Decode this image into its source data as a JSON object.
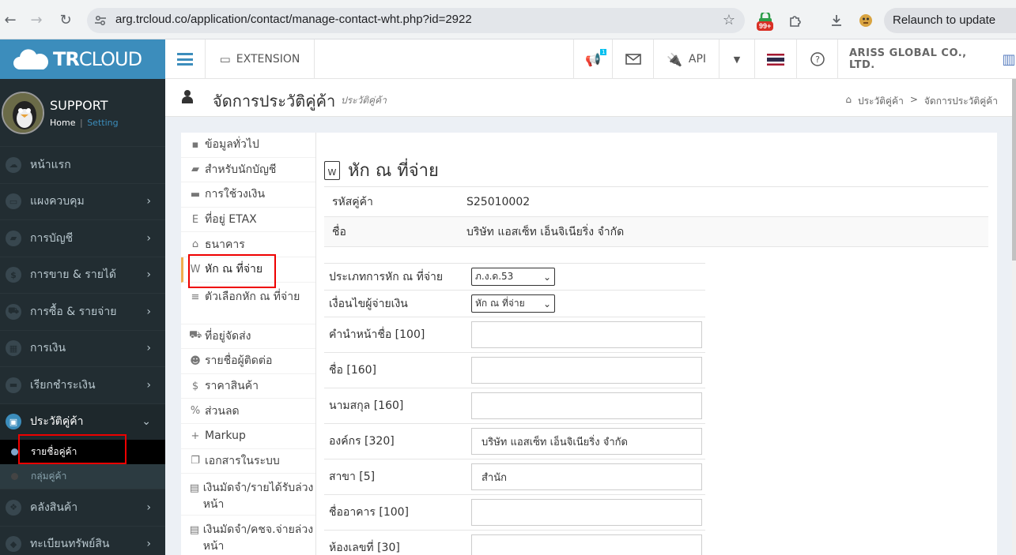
{
  "browser": {
    "url": "arg.trcloud.co/application/contact/manage-contact-wht.php?id=2922",
    "extension_badge": "99+",
    "relaunch_label": "Relaunch to update"
  },
  "brand": {
    "bold": "TR",
    "rest": "CLOUD"
  },
  "topbar": {
    "extension_label": "EXTENSION",
    "notification_count": "1",
    "api_label": "API",
    "company_name": "ARISS GLOBAL CO., LTD."
  },
  "user": {
    "name": "SUPPORT",
    "home_link": "Home",
    "separator": "|",
    "setting_link": "Setting"
  },
  "sidebar": {
    "items": [
      {
        "label": "หน้าแรก",
        "icon": "cloud-icon",
        "glyph": "☁",
        "has_arrow": false
      },
      {
        "label": "แผงควบคุม",
        "icon": "monitor-icon",
        "glyph": "▭",
        "has_arrow": true
      },
      {
        "label": "การบัญชี",
        "icon": "book-icon",
        "glyph": "▰",
        "has_arrow": true
      },
      {
        "label": "การขาย & รายได้",
        "icon": "dollar-icon",
        "glyph": "$",
        "has_arrow": true
      },
      {
        "label": "การซื้อ & รายจ่าย",
        "icon": "cart-icon",
        "glyph": "⛟",
        "has_arrow": true
      },
      {
        "label": "การเงิน",
        "icon": "calendar-icon",
        "glyph": "▦",
        "has_arrow": true
      },
      {
        "label": "เรียกชำระเงิน",
        "icon": "credit-card-icon",
        "glyph": "▬",
        "has_arrow": true
      },
      {
        "label": "ประวัติคู่ค้า",
        "icon": "contact-book-icon",
        "glyph": "▣",
        "has_arrow": true
      }
    ],
    "sub_items": [
      {
        "label": "รายชื่อคู่ค้า"
      },
      {
        "label": "กลุ่มคู่ค้า"
      }
    ],
    "bottom_items": [
      {
        "label": "คลังสินค้า",
        "icon": "cubes-icon",
        "glyph": "❖"
      },
      {
        "label": "ทะเบียนทรัพย์สิน",
        "icon": "diamond-icon",
        "glyph": "◆"
      }
    ]
  },
  "page": {
    "title": "จัดการประวัติคู่ค้า",
    "subtitle": "ประวัติคู่ค้า",
    "breadcrumb": [
      "ประวัติคู่ค้า",
      ">",
      "จัดการประวัติคู่ค้า"
    ]
  },
  "subnav": [
    {
      "label": "ข้อมูลทั่วไป",
      "glyph": "▪"
    },
    {
      "label": "สำหรับนักบัญชี",
      "glyph": "▰"
    },
    {
      "label": "การใช้วงเงิน",
      "glyph": "▬"
    },
    {
      "label": "ที่อยู่ ETAX",
      "glyph": "E"
    },
    {
      "label": "ธนาคาร",
      "glyph": "⌂"
    },
    {
      "label": "หัก ณ ที่จ่าย",
      "glyph": "W"
    },
    {
      "label": "ตัวเลือกหัก ณ ที่จ่าย",
      "glyph": "≡"
    },
    {
      "label": "ที่อยู่จัดส่ง",
      "glyph": "⛟"
    },
    {
      "label": "รายชื่อผู้ติดต่อ",
      "glyph": "☻"
    },
    {
      "label": "ราคาสินค้า",
      "glyph": "$"
    },
    {
      "label": "ส่วนลด",
      "glyph": "%"
    },
    {
      "label": "Markup",
      "glyph": "+"
    },
    {
      "label": "เอกสารในระบบ",
      "glyph": "❐"
    },
    {
      "label": "เงินมัดจำ/รายได้รับล่วงหน้า",
      "glyph": "▤"
    },
    {
      "label": "เงินมัดจำ/คชจ.จ่ายล่วงหน้า",
      "glyph": "▤"
    }
  ],
  "form": {
    "title": "หัก ณ ที่จ่าย",
    "info": [
      {
        "label": "รหัสคู่ค้า",
        "value": "S25010002"
      },
      {
        "label": "ชื่อ",
        "value": "บริษัท แอสเซ็ท เอ็นจิเนียริ่ง จำกัด"
      }
    ],
    "selects": [
      {
        "label": "ประเภทการหัก ณ ที่จ่าย",
        "value": "ภ.ง.ด.53"
      },
      {
        "label": "เงื่อนไขผู้จ่ายเงิน",
        "value": "หัก ณ ที่จ่าย"
      }
    ],
    "fields": [
      {
        "label": "คำนำหน้าชื่อ [100]",
        "value": ""
      },
      {
        "label": "ชื่อ [160]",
        "value": ""
      },
      {
        "label": "นามสกุล [160]",
        "value": ""
      },
      {
        "label": "องค์กร [320]",
        "value": "บริษัท แอสเซ็ท เอ็นจิเนียริ่ง จำกัด"
      },
      {
        "label": "สาขา [5]",
        "value": "สำนัก"
      },
      {
        "label": "ชื่ออาคาร [100]",
        "value": ""
      },
      {
        "label": "ห้องเลขที่ [30]",
        "value": ""
      }
    ]
  }
}
